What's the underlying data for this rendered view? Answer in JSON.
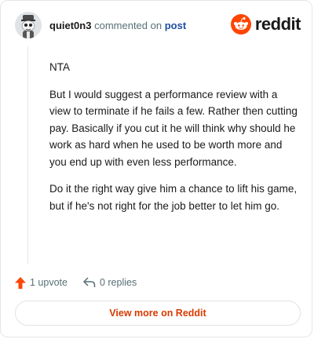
{
  "header": {
    "username": "quiet0n3",
    "action_text": "commented on",
    "post_link": "post",
    "logo_text": "reddit"
  },
  "comment": {
    "paragraphs": [
      "NTA",
      "But I would suggest a performance review with a view to terminate if he fails a few. Rather then cutting pay. Basically if you cut it he will think why should he work as hard when he used to be worth more and you end up with even less performance.",
      "Do it the right way give him a chance to lift his game, but if he's not right for the job better to let him go."
    ]
  },
  "actions": {
    "upvote_label": "1 upvote",
    "replies_label": "0 replies",
    "upvote_icon": "upvote-arrow-icon",
    "reply_icon": "reply-icon"
  },
  "footer": {
    "view_more_label": "View more on Reddit"
  },
  "colors": {
    "brand": "#ff4500",
    "link": "#1f4fa3",
    "view_more": "#d93a00",
    "muted": "#576f76"
  }
}
